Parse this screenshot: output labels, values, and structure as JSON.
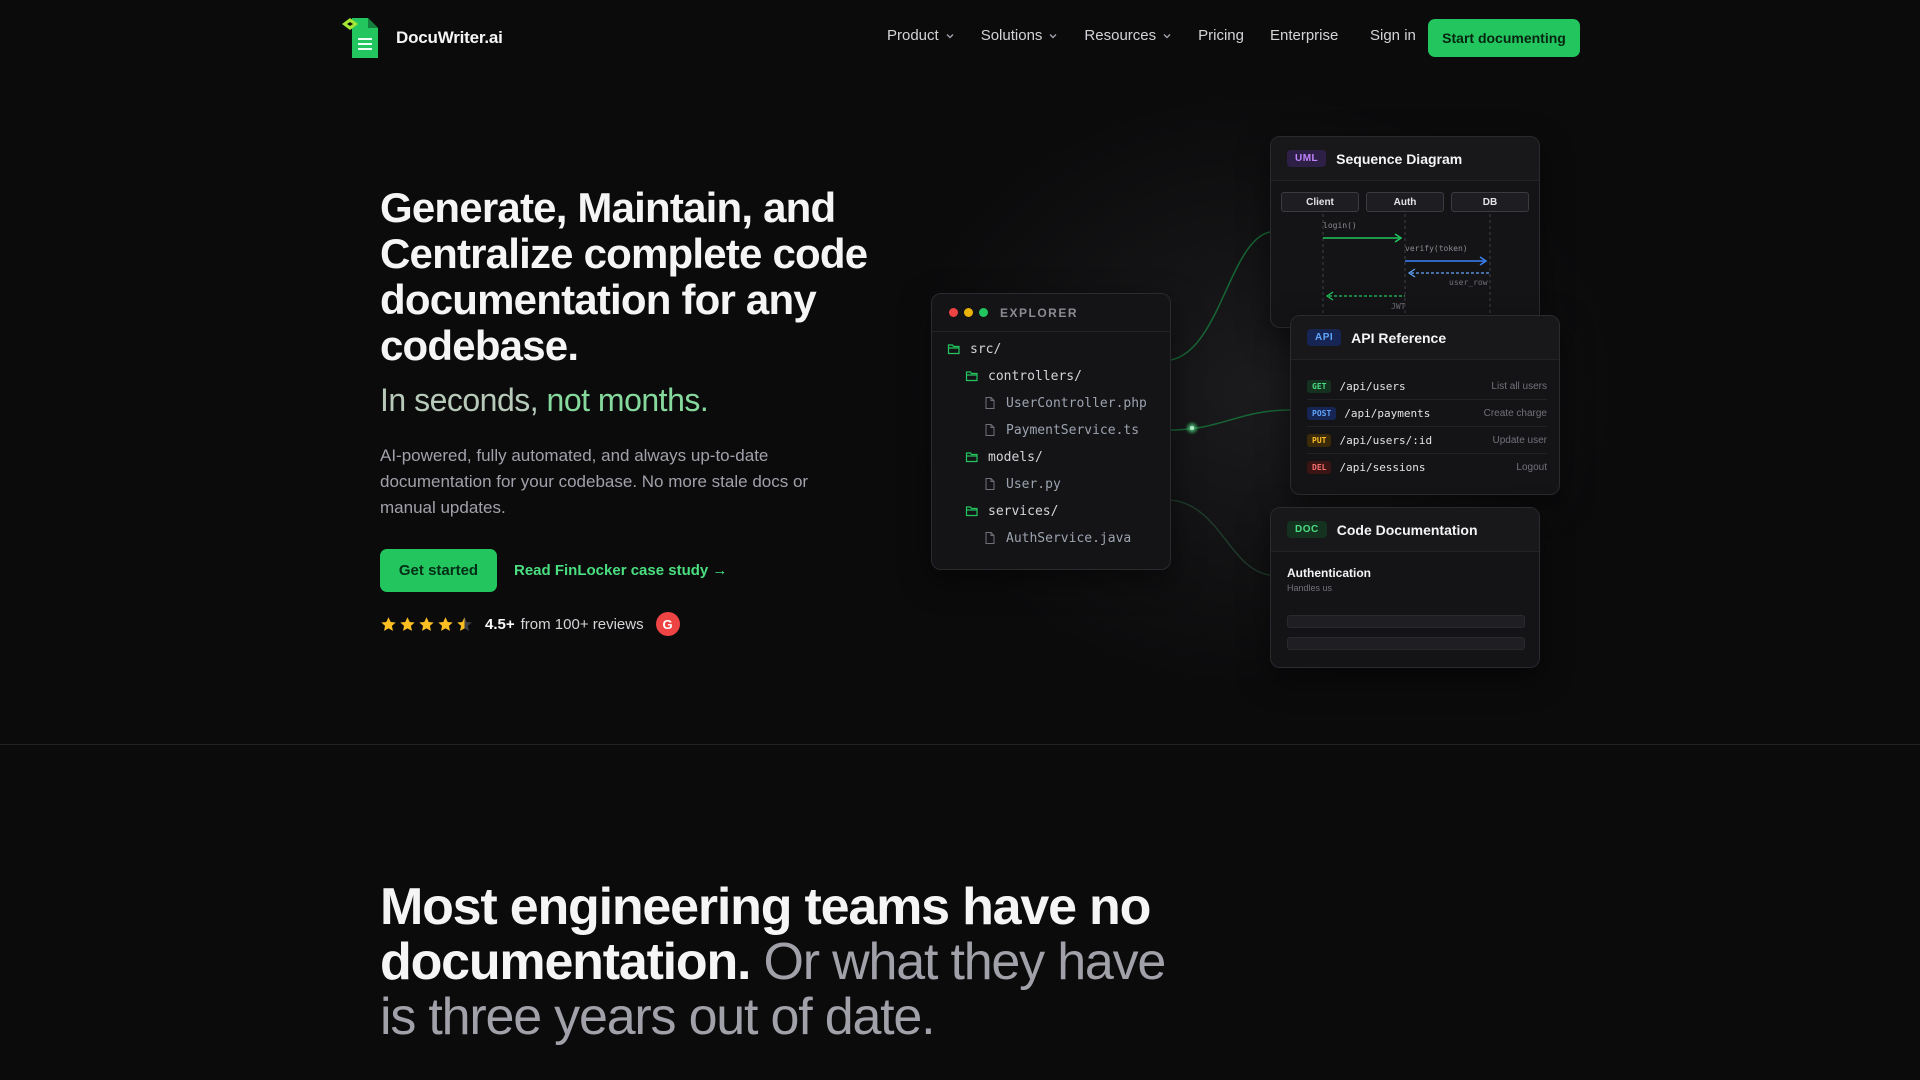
{
  "brand": {
    "name": "DocuWriter.ai",
    "accent": "#22c55e"
  },
  "nav": {
    "items": [
      {
        "label": "Product",
        "has_menu": true
      },
      {
        "label": "Solutions",
        "has_menu": true
      },
      {
        "label": "Resources",
        "has_menu": true
      },
      {
        "label": "Pricing",
        "has_menu": false
      },
      {
        "label": "Enterprise",
        "has_menu": false
      }
    ],
    "signin": "Sign in",
    "cta": "Start documenting"
  },
  "hero": {
    "title": "Generate, Maintain, and Centralize complete code documentation for any codebase.",
    "subtitle_a": "In seconds, ",
    "subtitle_b": "not months.",
    "description": "AI-powered, fully automated, and always up-to-date documentation for your codebase. No more stale docs or manual updates.",
    "primary_button": "Get started",
    "secondary_link": "Read FinLocker case study →",
    "rating_value": "4.5+",
    "rating_text": "from 100+ reviews",
    "rating_stars": 4.5,
    "review_badge": "G"
  },
  "explorer": {
    "title": "EXPLORER",
    "items": [
      {
        "label": "src/",
        "type": "folder"
      },
      {
        "label": "controllers/",
        "type": "folder"
      },
      {
        "label": "UserController.php",
        "type": "file"
      },
      {
        "label": "PaymentService.ts",
        "type": "file"
      },
      {
        "label": "models/",
        "type": "folder"
      },
      {
        "label": "User.py",
        "type": "file"
      },
      {
        "label": "services/",
        "type": "folder"
      },
      {
        "label": "AuthService.java",
        "type": "file"
      }
    ]
  },
  "sequence": {
    "badge": "UML",
    "title": "Sequence Diagram",
    "actors": [
      "Client",
      "Auth",
      "DB"
    ],
    "messages": [
      "login()",
      "verify(token)",
      "user_row",
      "JWT"
    ]
  },
  "api": {
    "badge": "API",
    "title": "API Reference",
    "endpoints": [
      {
        "method": "GET",
        "path": "/api/users",
        "desc": "List all users"
      },
      {
        "method": "POST",
        "path": "/api/payments",
        "desc": "Create charge"
      },
      {
        "method": "PUT",
        "path": "/api/users/:id",
        "desc": "Update user"
      },
      {
        "method": "DEL",
        "path": "/api/sessions",
        "desc": "Logout"
      }
    ]
  },
  "doc": {
    "badge": "DOC",
    "title": "Code Documentation",
    "heading": "Authentication",
    "snippet": "Handles us"
  },
  "section": {
    "title_strong": "Most engineering teams have no documentation.",
    "title_muted": " Or what they have is three years out of date."
  }
}
